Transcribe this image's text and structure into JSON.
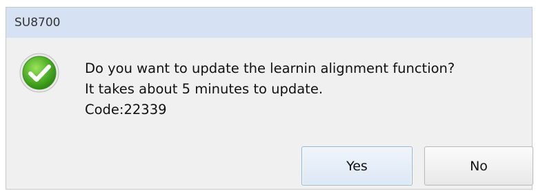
{
  "window": {
    "title": "SU8700"
  },
  "icon": {
    "name": "success-check-icon",
    "color": "#5bb82a"
  },
  "message": {
    "line1": "Do you want to update the learnin alignment function?",
    "line2": "It takes about 5 minutes to update.",
    "line3": "Code:22339"
  },
  "buttons": {
    "yes_label": "Yes",
    "no_label": "No"
  },
  "colors": {
    "titlebar": "#d6e2f3",
    "dialog_bg": "#f0f0f0",
    "default_button_border": "#8fb4dd"
  }
}
